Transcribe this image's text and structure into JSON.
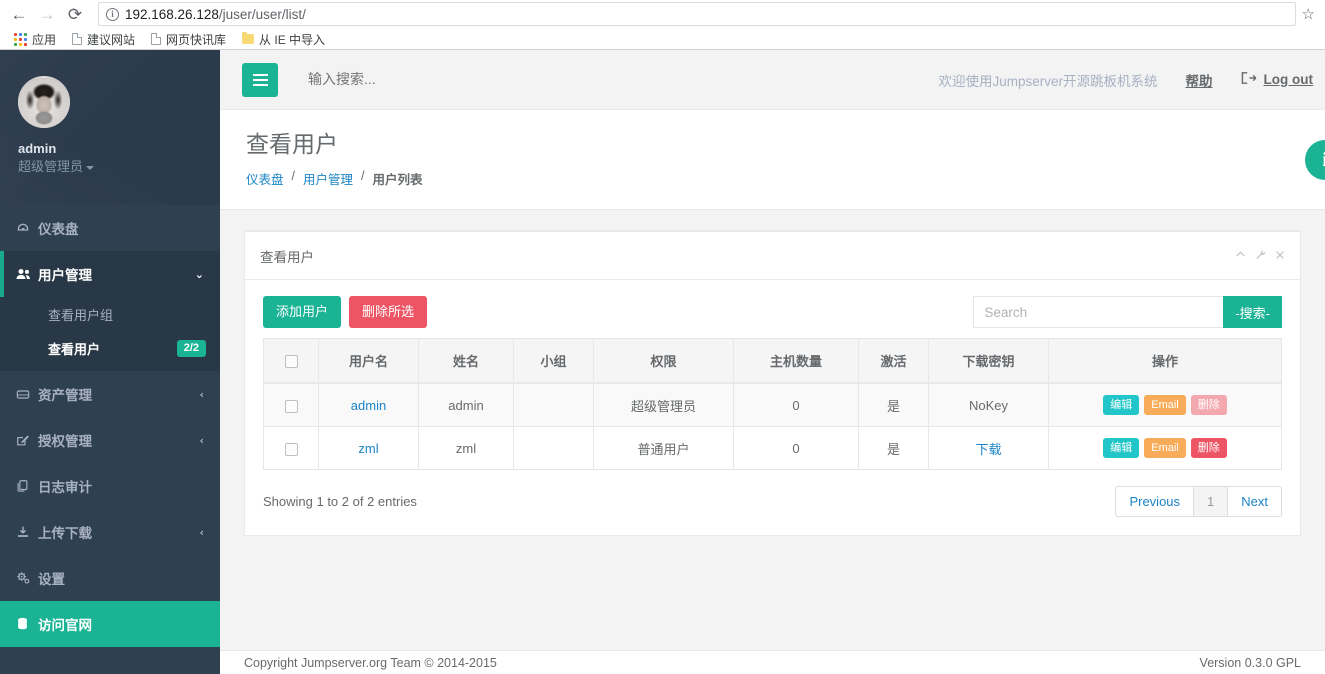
{
  "browser": {
    "back_icon": "←",
    "forward_icon": "→",
    "reload_icon": "⟳",
    "site_info_icon": "i",
    "url_host": "192.168.26.128",
    "url_path": "/juser/user/list/",
    "star_icon": "☆",
    "bookmarks": [
      {
        "label": "应用",
        "icon": "apps-grid-icon"
      },
      {
        "label": "建议网站",
        "icon": "page-icon"
      },
      {
        "label": "网页快讯库",
        "icon": "page-icon"
      },
      {
        "label": "从 IE 中导入",
        "icon": "folder-icon"
      }
    ]
  },
  "sidebar": {
    "profile": {
      "name": "admin",
      "role": "超级管理员",
      "avatar_icon": "avatar-photo"
    },
    "items": [
      {
        "label": "仪表盘",
        "icon": "dashboard-icon",
        "arrow": ""
      },
      {
        "label": "用户管理",
        "icon": "users-icon",
        "arrow": "⌄"
      },
      {
        "label": "资产管理",
        "icon": "server-icon",
        "arrow": "‹"
      },
      {
        "label": "授权管理",
        "icon": "edit-square-icon",
        "arrow": "‹"
      },
      {
        "label": "日志审计",
        "icon": "files-icon",
        "arrow": ""
      },
      {
        "label": "上传下载",
        "icon": "download-icon",
        "arrow": "‹"
      },
      {
        "label": "设置",
        "icon": "gears-icon",
        "arrow": ""
      },
      {
        "label": "访问官网",
        "icon": "database-icon",
        "arrow": ""
      }
    ],
    "subitems": [
      {
        "label": "查看用户组",
        "badge": ""
      },
      {
        "label": "查看用户",
        "badge": "2/2"
      }
    ]
  },
  "topnav": {
    "hamburger_icon": "hamburger-icon",
    "search_placeholder": "输入搜索...",
    "search_value": "",
    "welcome": "欢迎使用Jumpserver开源跳板机系统",
    "help": "帮助",
    "logout": "Log out",
    "logout_icon": "sign-out-icon"
  },
  "page": {
    "title": "查看用户",
    "breadcrumb": [
      {
        "label": "仪表盘",
        "link": true
      },
      {
        "label": "用户管理",
        "link": true
      },
      {
        "label": "用户列表",
        "link": false
      }
    ],
    "breadcrumb_sep": "/",
    "float_button_icon": "info-circle-icon",
    "float_button_label": "i"
  },
  "panel": {
    "title": "查看用户",
    "tools": [
      {
        "icon": "chevron-up-icon",
        "glyph": "⌃"
      },
      {
        "icon": "wrench-icon",
        "glyph": "✎"
      },
      {
        "icon": "close-icon",
        "glyph": "✕"
      }
    ],
    "add_button": "添加用户",
    "delete_selected_button": "删除所选",
    "search_placeholder": "Search",
    "search_value": "",
    "search_button": "-搜索-"
  },
  "table": {
    "columns": [
      "",
      "用户名",
      "姓名",
      "小组",
      "权限",
      "主机数量",
      "激活",
      "下载密钥",
      "操作"
    ],
    "rows": [
      {
        "username": "admin",
        "name": "admin",
        "group": "",
        "role": "超级管理员",
        "host_count": "0",
        "active": "是",
        "key": "NoKey",
        "key_is_link": false,
        "actions": [
          {
            "label": "编辑",
            "style": "edit"
          },
          {
            "label": "Email",
            "style": "email"
          },
          {
            "label": "删除",
            "style": "del-muted"
          }
        ]
      },
      {
        "username": "zml",
        "name": "zml",
        "group": "",
        "role": "普通用户",
        "host_count": "0",
        "active": "是",
        "key": "下载",
        "key_is_link": true,
        "actions": [
          {
            "label": "编辑",
            "style": "edit"
          },
          {
            "label": "Email",
            "style": "email"
          },
          {
            "label": "删除",
            "style": "del"
          }
        ]
      }
    ],
    "entries_info": "Showing 1 to 2 of 2 entries",
    "pagination": {
      "previous": "Previous",
      "current": "1",
      "next": "Next"
    }
  },
  "footer": {
    "copyright": "Copyright Jumpserver.org Team © 2014-2015",
    "version": "Version 0.3.0 GPL"
  },
  "colors": {
    "accent": "#1ab394",
    "sidebar_bg": "#2f4050",
    "sidebar_sub_bg": "#293846",
    "danger": "#ed5565",
    "info": "#23c6c8",
    "warning": "#f8ac59",
    "link": "#1c84c6"
  }
}
